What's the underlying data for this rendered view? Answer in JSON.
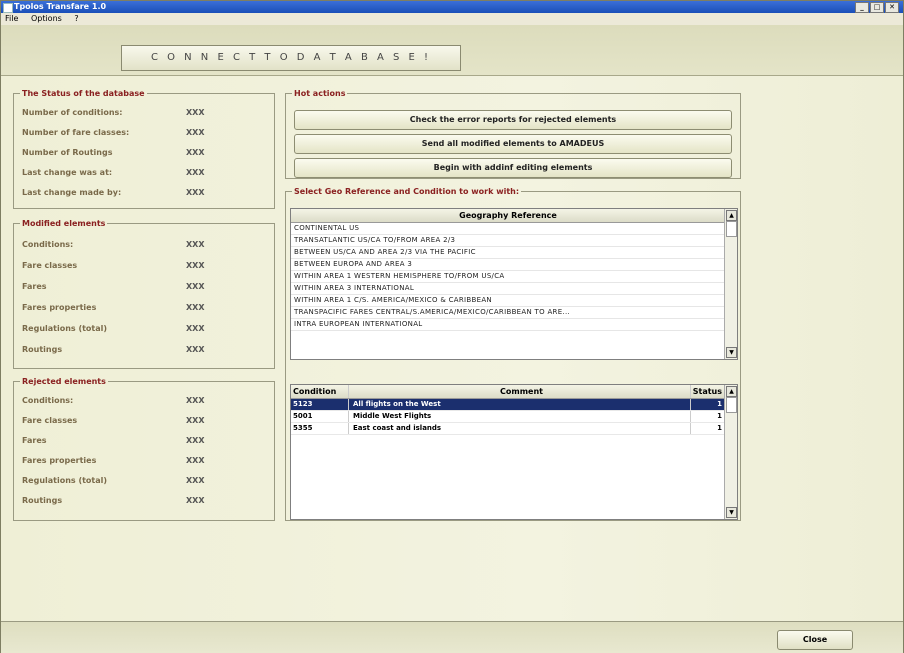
{
  "window": {
    "title": "Tpolos Transfare 1.0",
    "controls": [
      "_",
      "□",
      "✕"
    ]
  },
  "menu": [
    "File",
    "Options",
    "?"
  ],
  "connect_label": "C O N N E C T   T O   D A T A B A S E !",
  "status": {
    "legend": "The Status of the database",
    "rows": [
      {
        "label": "Number of conditions:",
        "value": "XXX"
      },
      {
        "label": "Number of fare classes:",
        "value": "XXX"
      },
      {
        "label": "Number of Routings",
        "value": "XXX"
      },
      {
        "label": "Last change was at:",
        "value": "XXX"
      },
      {
        "label": "Last change made by:",
        "value": "XXX"
      }
    ]
  },
  "modified": {
    "legend": "Modified elements",
    "rows": [
      {
        "label": "Conditions:",
        "value": "XXX"
      },
      {
        "label": "Fare classes",
        "value": "XXX"
      },
      {
        "label": "Fares",
        "value": "XXX"
      },
      {
        "label": "Fares properties",
        "value": "XXX"
      },
      {
        "label": "Regulations (total)",
        "value": "XXX"
      },
      {
        "label": "Routings",
        "value": "XXX"
      }
    ]
  },
  "rejected": {
    "legend": "Rejected elements",
    "rows": [
      {
        "label": "Conditions:",
        "value": "XXX"
      },
      {
        "label": "Fare classes",
        "value": "XXX"
      },
      {
        "label": "Fares",
        "value": "XXX"
      },
      {
        "label": "Fares properties",
        "value": "XXX"
      },
      {
        "label": "Regulations (total)",
        "value": "XXX"
      },
      {
        "label": "Routings",
        "value": "XXX"
      }
    ]
  },
  "hot": {
    "legend": "Hot actions",
    "buttons": [
      "Check the error reports for rejected elements",
      "Send all modified elements to AMADEUS",
      "Begin with addinf editing elements"
    ]
  },
  "geo": {
    "legend": "Select Geo Reference and Condition to work with:",
    "header": "Geography Reference",
    "items": [
      "CONTINENTAL US",
      "TRANSATLANTIC US/CA TO/FROM AREA 2/3",
      "BETWEEN US/CA AND AREA 2/3 VIA THE PACIFIC",
      "BETWEEN EUROPA AND AREA 3",
      "WITHIN AREA 1 WESTERN HEMISPHERE TO/FROM US/CA",
      "WITHIN AREA 3 INTERNATIONAL",
      "WITHIN AREA 1 C/S. AMERICA/MEXICO & CARIBBEAN",
      "TRANSPACIFIC FARES CENTRAL/S.AMERICA/MEXICO/CARIBBEAN TO ARE...",
      "INTRA EUROPEAN INTERNATIONAL"
    ]
  },
  "conditions": {
    "headers": [
      "Condition",
      "Comment",
      "Status"
    ],
    "rows": [
      {
        "id": "5123",
        "comment": "All flights on the West",
        "status": "1",
        "selected": true
      },
      {
        "id": "5001",
        "comment": "Middle West Flights",
        "status": "1",
        "selected": false
      },
      {
        "id": "5355",
        "comment": "East coast and islands",
        "status": "1",
        "selected": false
      }
    ]
  },
  "close_label": "Close"
}
